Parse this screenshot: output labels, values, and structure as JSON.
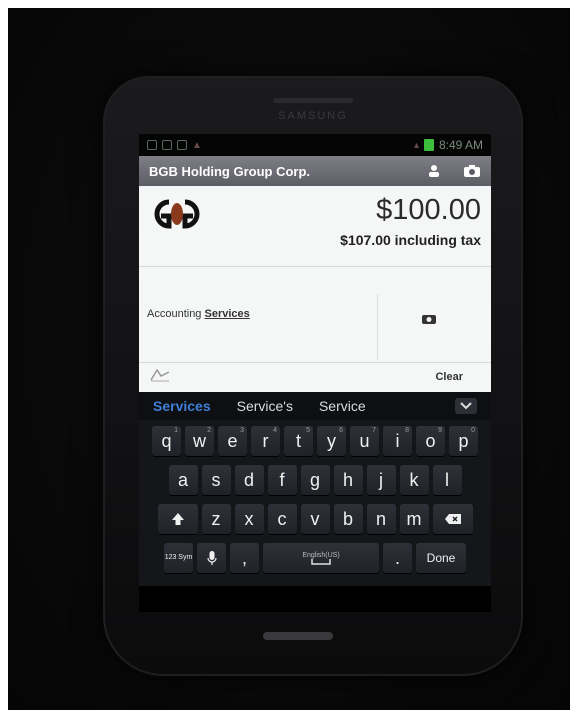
{
  "status_bar": {
    "time": "8:49 AM"
  },
  "phone": {
    "brand": "SAMSUNG"
  },
  "app_bar": {
    "title": "BGB Holding Group Corp.",
    "icons": [
      "person-icon",
      "camera-icon"
    ]
  },
  "payment": {
    "amount": "$100.00",
    "amount_with_tax": "$107.00 including tax"
  },
  "description": {
    "prefix": "Accounting",
    "highlighted": "Services"
  },
  "footer": {
    "clear_label": "Clear"
  },
  "suggestions": [
    "Services",
    "Service's",
    "Service"
  ],
  "keyboard": {
    "row1": [
      "q",
      "w",
      "e",
      "r",
      "t",
      "y",
      "u",
      "i",
      "o",
      "p"
    ],
    "row1_hints": [
      "1",
      "2",
      "3",
      "4",
      "5",
      "6",
      "7",
      "8",
      "9",
      "0"
    ],
    "row2": [
      "a",
      "s",
      "d",
      "f",
      "g",
      "h",
      "j",
      "k",
      "l"
    ],
    "row3": [
      "z",
      "x",
      "c",
      "v",
      "b",
      "n",
      "m"
    ],
    "sym_label": "123 Sym",
    "space_label": "English(US)",
    "done_label": "Done"
  },
  "colors": {
    "app_bar": "#6e6e76",
    "suggestion_active": "#3f7fd6",
    "battery": "#3cbd3c"
  }
}
